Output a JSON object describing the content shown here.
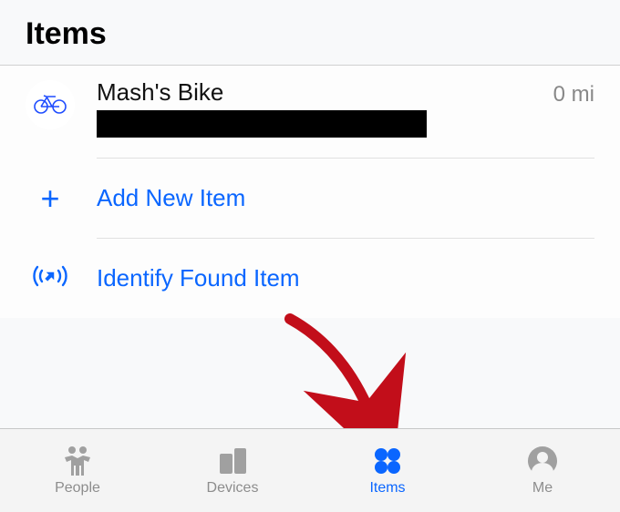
{
  "header": {
    "title": "Items"
  },
  "items": [
    {
      "name": "Mash's Bike",
      "subtitle_redacted": true,
      "distance": "0 mi",
      "icon": "bike-icon"
    }
  ],
  "actions": {
    "add_label": "Add New Item",
    "identify_label": "Identify Found Item"
  },
  "tabs": {
    "people": "People",
    "devices": "Devices",
    "items": "Items",
    "me": "Me",
    "active": "items"
  },
  "colors": {
    "accent": "#0a66ff",
    "inactive": "#a0a0a0",
    "arrow": "#c20e1a"
  }
}
